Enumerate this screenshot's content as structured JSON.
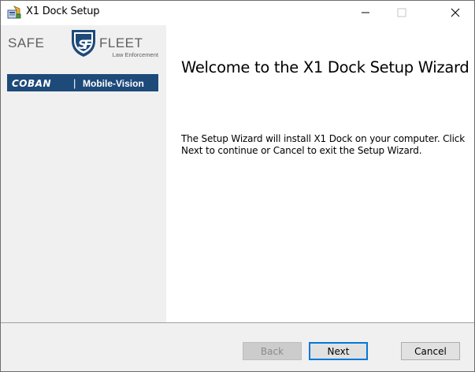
{
  "window": {
    "title": "X1 Dock Setup"
  },
  "logo": {
    "brand_left": "SAFE",
    "brand_right": "FLEET",
    "brand_sub": "Law Enforcement",
    "coban": "COBAN",
    "separator": "|",
    "mobile_vision": "Mobile-Vision",
    "colors": {
      "navy": "#1e4a7a",
      "gray": "#7a7a7a"
    }
  },
  "main": {
    "heading": "Welcome to the X1 Dock Setup Wizard",
    "description": "The Setup Wizard will install X1 Dock on your computer. Click Next to continue or Cancel to exit the Setup Wizard."
  },
  "footer": {
    "back_label": "Back",
    "next_label": "Next",
    "cancel_label": "Cancel"
  },
  "icons": {
    "app": "installer-icon",
    "minimize": "minimize-icon",
    "maximize": "maximize-icon",
    "close": "close-icon"
  }
}
